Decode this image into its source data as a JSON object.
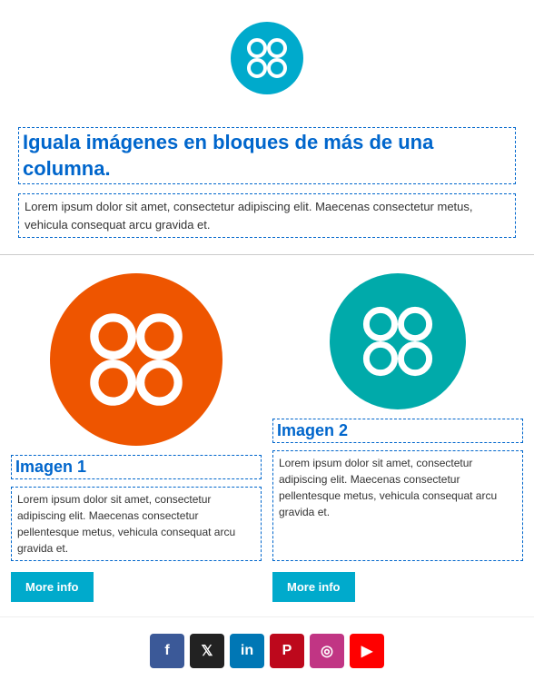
{
  "header": {
    "logo_alt": "App logo"
  },
  "intro": {
    "title": "Iguala imágenes en bloques de más de una columna.",
    "body": "Lorem ipsum dolor sit amet, consectetur adipiscing elit. Maecenas consectetur metus, vehicula consequat arcu gravida et."
  },
  "columns": [
    {
      "id": "col1",
      "image_alt": "Image 1 orange logo",
      "title": "Imagen 1",
      "body": "Lorem ipsum dolor sit amet, consectetur adipiscing elit. Maecenas consectetur pellentesque metus, vehicula consequat arcu gravida et.",
      "button_label": "More info"
    },
    {
      "id": "col2",
      "image_alt": "Image 2 teal logo",
      "title": "Imagen 2",
      "body": "Lorem ipsum dolor sit amet, consectetur adipiscing elit. Maecenas consectetur pellentesque metus, vehicula consequat arcu gravida et.",
      "button_label": "More info"
    }
  ],
  "footer": {
    "social": [
      {
        "name": "facebook",
        "label": "f",
        "class": "si-facebook"
      },
      {
        "name": "twitter",
        "label": "𝕏",
        "class": "si-twitter"
      },
      {
        "name": "linkedin",
        "label": "in",
        "class": "si-linkedin"
      },
      {
        "name": "pinterest",
        "label": "p",
        "class": "si-pinterest"
      },
      {
        "name": "instagram",
        "label": "◎",
        "class": "si-instagram"
      },
      {
        "name": "youtube",
        "label": "▶",
        "class": "si-youtube"
      }
    ]
  }
}
